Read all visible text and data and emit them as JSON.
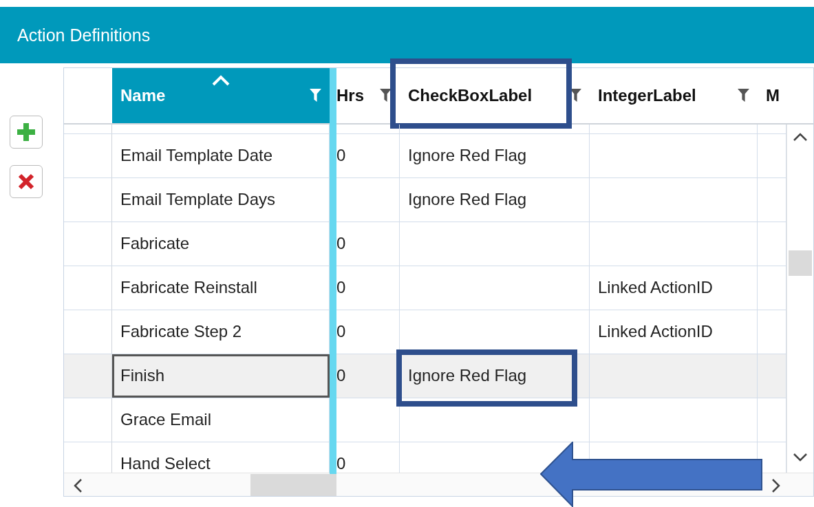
{
  "window": {
    "title": "Action Definitions"
  },
  "toolbar": [
    {
      "kind": "add"
    },
    {
      "kind": "delete"
    }
  ],
  "table": {
    "columns": [
      {
        "label": "Name",
        "selected": true,
        "sorted": true,
        "highlighted": false
      },
      {
        "label": "Hrs",
        "selected": false,
        "sorted": false,
        "highlighted": false
      },
      {
        "label": "CheckBoxLabel",
        "selected": false,
        "sorted": false,
        "highlighted": true
      },
      {
        "label": "IntegerLabel",
        "selected": false,
        "sorted": false,
        "highlighted": false
      },
      {
        "label": "M",
        "selected": false,
        "sorted": false,
        "highlighted": false
      }
    ],
    "rows": [
      {
        "name": "Email Template Date",
        "hrs": "0",
        "checkbox_label": "Ignore Red Flag",
        "selected": false,
        "highlighted": false
      },
      {
        "name": "Email Template Days",
        "checkbox_label": "Ignore Red Flag",
        "selected": false,
        "highlighted": false
      },
      {
        "name": "Fabricate",
        "hrs": "0",
        "selected": false,
        "highlighted": false
      },
      {
        "name": "Fabricate Reinstall",
        "hrs": "0",
        "integer_label": "Linked ActionID",
        "selected": false,
        "highlighted": false
      },
      {
        "name": "Fabricate Step 2",
        "hrs": "0",
        "integer_label": "Linked ActionID",
        "selected": false,
        "highlighted": false
      },
      {
        "name": "Finish",
        "hrs": "0",
        "checkbox_label": "Ignore Red Flag",
        "selected": true,
        "highlighted": true
      },
      {
        "name": "Grace Email",
        "selected": false,
        "highlighted": false
      },
      {
        "name": "Hand Select",
        "hrs": "0",
        "selected": false,
        "highlighted": false
      }
    ]
  },
  "annotations": [
    {
      "kind": "arrow"
    }
  ]
}
